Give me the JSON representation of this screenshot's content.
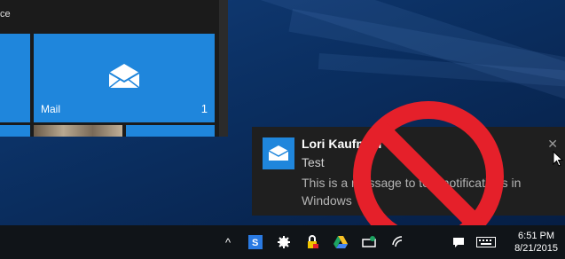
{
  "start_menu": {
    "top_label": "ce",
    "mail_tile": {
      "name": "Mail",
      "count": "1"
    }
  },
  "notification": {
    "sender": "Lori Kaufman",
    "subject": "Test",
    "body": "This is a message to test notifications in Windows",
    "close_glyph": "✕"
  },
  "taskbar": {
    "chevron_glyph": "^",
    "tray_icons": [
      "show-hidden-icons",
      "skype-icon",
      "settings-gear-icon",
      "security-lock-icon",
      "google-drive-icon",
      "usb-device-icon",
      "wifi-icon",
      "volume-icon",
      "action-center-icon",
      "keyboard-icon"
    ],
    "time": "6:51 PM",
    "date": "8/21/2015"
  },
  "colors": {
    "tile_blue": "#1f86dc",
    "toast_bg": "#1f1f1f",
    "prohibit_red": "#e5202a"
  }
}
